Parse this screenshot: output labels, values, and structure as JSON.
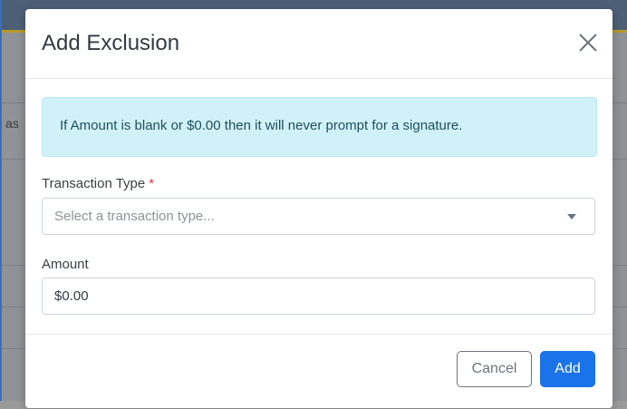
{
  "modal": {
    "title": "Add Exclusion",
    "close_icon": "close-icon",
    "info_message": "If Amount is blank or $0.00 then it will never prompt for a signature.",
    "transaction_type": {
      "label": "Transaction Type",
      "required_marker": "*",
      "placeholder": "Select a transaction type..."
    },
    "amount": {
      "label": "Amount",
      "value": "$0.00"
    },
    "footer": {
      "cancel_label": "Cancel",
      "add_label": "Add"
    }
  },
  "background": {
    "partial_text": "as"
  },
  "colors": {
    "primary": "#1a73e8",
    "info_bg": "#d1f1f8",
    "required": "#d33a3a",
    "backdrop": "#8f9296"
  }
}
